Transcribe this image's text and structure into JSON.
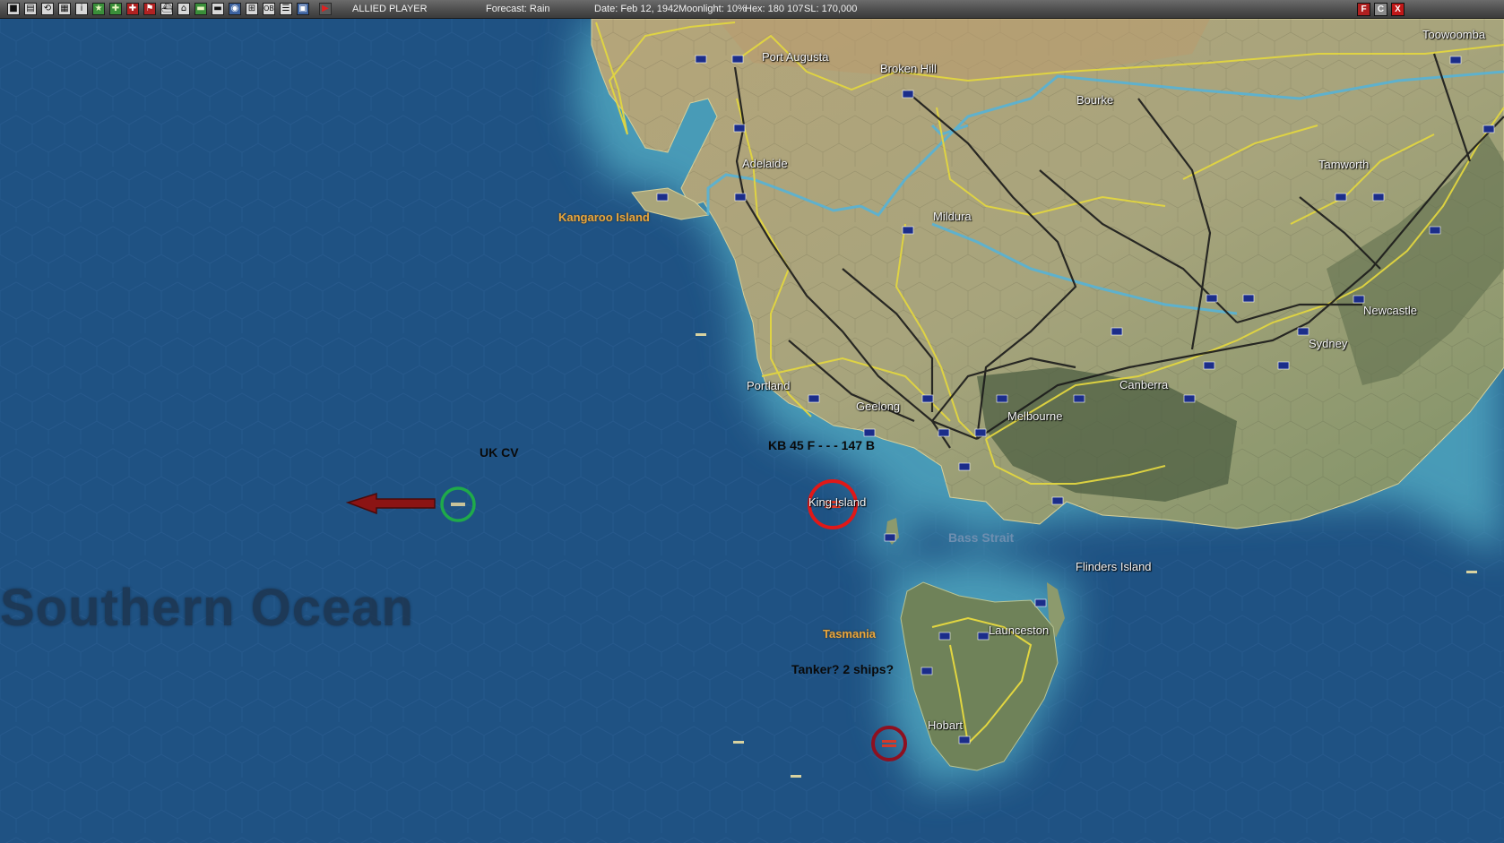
{
  "toolbar": {
    "buttons": [
      "■",
      "▤",
      "⟲",
      "▦",
      "i",
      "★",
      "✚",
      "✚",
      "⚑",
      "⛴",
      "⌂",
      "▬",
      "▬",
      "◉",
      "⊞",
      "OB",
      "☰",
      "▣",
      "▶"
    ],
    "side": "ALLIED PLAYER",
    "forecast": "Forecast: Rain",
    "date": "Date: Feb 12, 1942",
    "moonlight": "Moonlight: 10%",
    "hex": "Hex: 180 107",
    "sl": "SL: 170,000",
    "window_buttons": [
      "F",
      "C",
      "X"
    ]
  },
  "map": {
    "labels": {
      "port_augusta": "Port Augusta",
      "broken_hill": "Broken Hill",
      "bourke": "Bourke",
      "toowoomba": "Toowoomba",
      "adelaide": "Adelaide",
      "tamworth": "Tamworth",
      "kangaroo_island": "Kangaroo Island",
      "mildura": "Mildura",
      "newcastle": "Newcastle",
      "sydney": "Sydney",
      "portland": "Portland",
      "canberra": "Canberra",
      "geelong": "Geelong",
      "melbourne": "Melbourne",
      "king_island": "King Island",
      "bass_strait": "Bass Strait",
      "flinders_island": "Flinders Island",
      "launceston": "Launceston",
      "tasmania": "Tasmania",
      "hobart": "Hobart",
      "southern_ocean": "Southern Ocean"
    },
    "annotations": {
      "uk_cv": "UK CV",
      "kb": "KB 45 F - - - 147 B",
      "tanker": "Tanker? 2 ships?"
    },
    "colors": {
      "ocean": "#1f5283",
      "land": "#a9a57a",
      "green_circle": "#1faa4a",
      "red_circle": "#e01818",
      "dark_red_circle": "#8e1020",
      "arrow": "#8b1414"
    }
  }
}
